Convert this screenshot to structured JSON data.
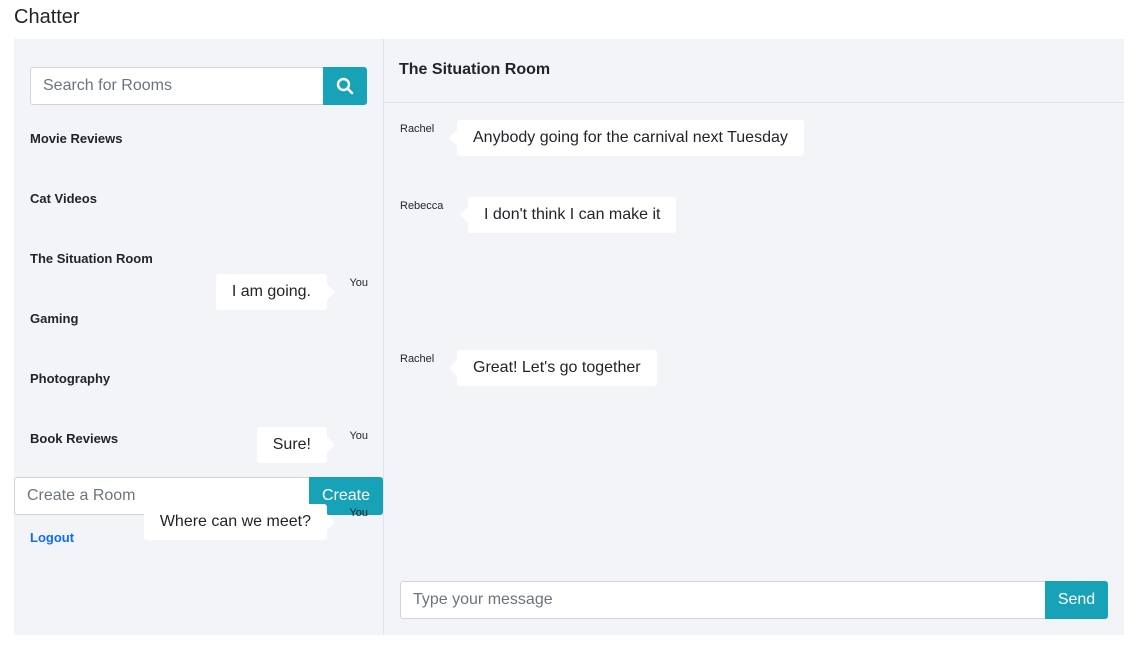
{
  "app": {
    "title": "Chatter"
  },
  "sidebar": {
    "search": {
      "placeholder": "Search for Rooms",
      "icon": "search-icon"
    },
    "rooms": [
      {
        "label": "Movie Reviews"
      },
      {
        "label": "Cat Videos"
      },
      {
        "label": "The Situation Room"
      },
      {
        "label": "Gaming"
      },
      {
        "label": "Photography"
      },
      {
        "label": "Book Reviews"
      }
    ],
    "create": {
      "placeholder": "Create a Room",
      "button_label": "Create"
    },
    "logout_label": "Logout"
  },
  "chat": {
    "room_title": "The Situation Room",
    "messages": [
      {
        "sender": "Rachel",
        "text": "Anybody going for the carnival next Tuesday",
        "side": "left"
      },
      {
        "sender": "Rebecca",
        "text": "I don't think I can make it",
        "side": "left"
      },
      {
        "sender": "You",
        "text": "I am going.",
        "side": "right"
      },
      {
        "sender": "Rachel",
        "text": "Great! Let's go together",
        "side": "left"
      },
      {
        "sender": "You",
        "text": "Sure!",
        "side": "right"
      },
      {
        "sender": "You",
        "text": "Where can we meet?",
        "side": "right"
      }
    ],
    "composer": {
      "placeholder": "Type your message",
      "send_label": "Send"
    }
  },
  "colors": {
    "accent": "#17a2b8",
    "panel_bg": "#f3f4f8",
    "link": "#0d6efd",
    "bubble": "#ffffff"
  }
}
